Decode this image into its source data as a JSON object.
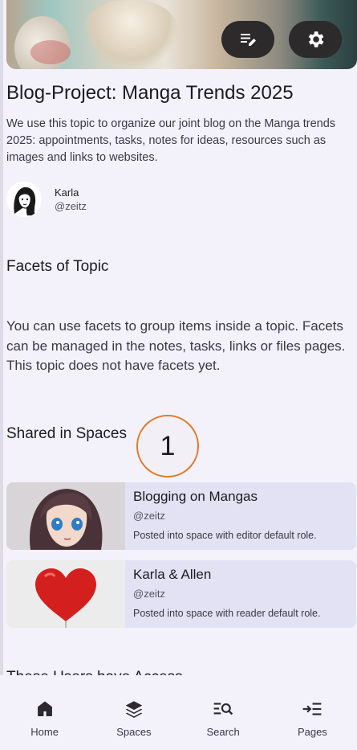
{
  "topic": {
    "title": "Blog-Project: Manga Trends 2025",
    "description": "We use this topic to organize our joint blog on the Manga trends 2025: appointments, tasks, notes for ideas, resources such as images and links to websites."
  },
  "author": {
    "name": "Karla",
    "handle": "@zeitz"
  },
  "facets": {
    "title": "Facets of Topic",
    "empty_text": "You can use facets to group items inside a topic. Facets can be managed in the notes, tasks, links or files pages. This topic does not have facets yet."
  },
  "shared": {
    "title": "Shared in Spaces",
    "marker": "1",
    "spaces": [
      {
        "name": "Blogging on Mangas",
        "handle": "@zeitz",
        "role": "Posted into space with editor default role."
      },
      {
        "name": "Karla & Allen",
        "handle": "@zeitz",
        "role": "Posted into space with reader default role."
      }
    ]
  },
  "users_title": "These Users have Access",
  "nav": [
    {
      "label": "Home",
      "icon": "home-icon"
    },
    {
      "label": "Spaces",
      "icon": "layers-icon"
    },
    {
      "label": "Search",
      "icon": "search-list-icon"
    },
    {
      "label": "Pages",
      "icon": "pages-icon"
    }
  ]
}
